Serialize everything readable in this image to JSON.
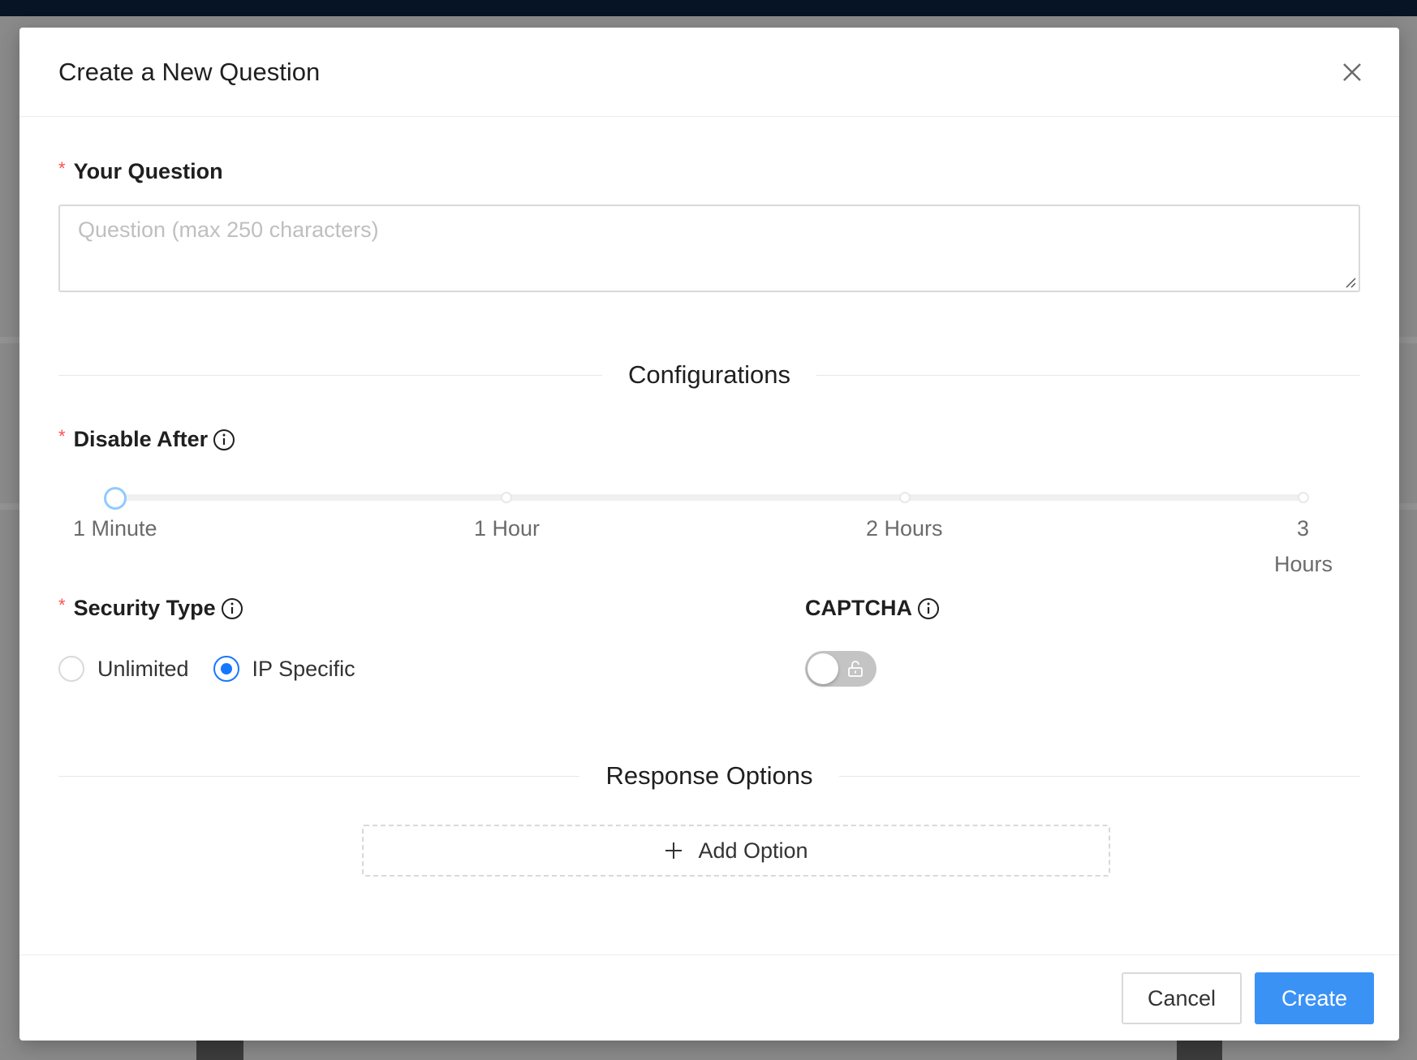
{
  "modal": {
    "title": "Create a New Question"
  },
  "question": {
    "label": "Your Question",
    "placeholder": "Question (max 250 characters)",
    "value": ""
  },
  "configurations": {
    "heading": "Configurations",
    "disable_after": {
      "label": "Disable After",
      "marks": [
        "1 Minute",
        "1 Hour",
        "2 Hours",
        "3",
        "Hours"
      ],
      "selected": "1 Minute"
    },
    "security_type": {
      "label": "Security Type",
      "options": [
        "Unlimited",
        "IP Specific"
      ],
      "selected": "IP Specific"
    },
    "captcha": {
      "label": "CAPTCHA",
      "enabled": false
    }
  },
  "response_options": {
    "heading": "Response Options",
    "add_option_label": "Add Option"
  },
  "footer": {
    "cancel_label": "Cancel",
    "create_label": "Create"
  },
  "colors": {
    "primary": "#3b92f5",
    "required": "#ff4d4f",
    "slider_handle": "#91caff"
  }
}
